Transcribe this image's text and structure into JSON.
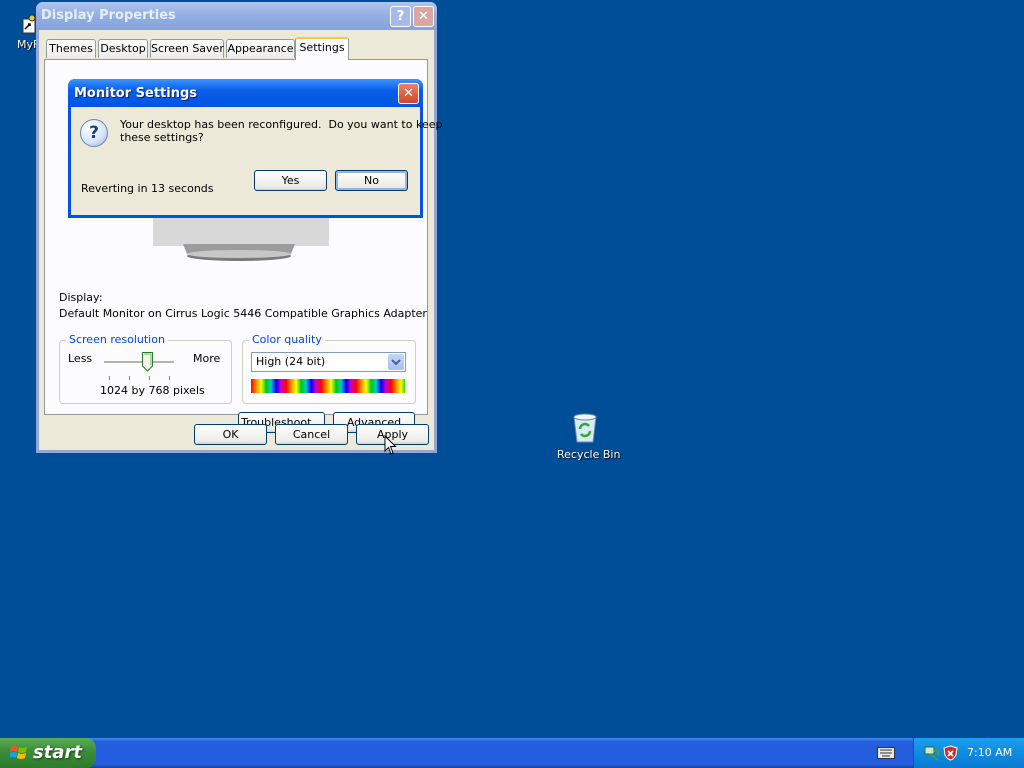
{
  "desktop": {
    "shortcut_label": "MyF",
    "recycle_bin_label": "Recycle Bin"
  },
  "window": {
    "title": "Display Properties",
    "help_glyph": "?",
    "close_glyph": "✕",
    "tabs": [
      {
        "label": "Themes"
      },
      {
        "label": "Desktop"
      },
      {
        "label": "Screen Saver"
      },
      {
        "label": "Appearance"
      },
      {
        "label": "Settings"
      }
    ],
    "active_tab": "Settings",
    "display_label": "Display:",
    "display_value": "Default Monitor on Cirrus Logic 5446 Compatible Graphics Adapter",
    "resolution": {
      "label": "Screen resolution",
      "less": "Less",
      "more": "More",
      "value_text": "1024 by 768 pixels",
      "slider_fraction": 0.65
    },
    "color_quality": {
      "label": "Color quality",
      "selected": "High (24 bit)"
    },
    "buttons": {
      "troubleshoot": "Troubleshoot...",
      "advanced": "Advanced",
      "ok": "OK",
      "cancel": "Cancel",
      "apply": "Apply"
    }
  },
  "dialog": {
    "title": "Monitor Settings",
    "close_glyph": "✕",
    "icon_glyph": "?",
    "message_line1": "Your desktop has been reconfigured.  Do you want to keep",
    "message_line2": "these settings?",
    "countdown": "Reverting in 13 seconds",
    "yes": "Yes",
    "no": "No"
  },
  "taskbar": {
    "start_label": "start",
    "clock": "7:10 AM"
  },
  "colors": {
    "desktop": "#004e98",
    "dialog_title": "#0054e3",
    "inactive_title": "#8fa8d9",
    "taskbar": "#245edc",
    "start_green": "#3c8f3b",
    "tray": "#0f8be0"
  }
}
